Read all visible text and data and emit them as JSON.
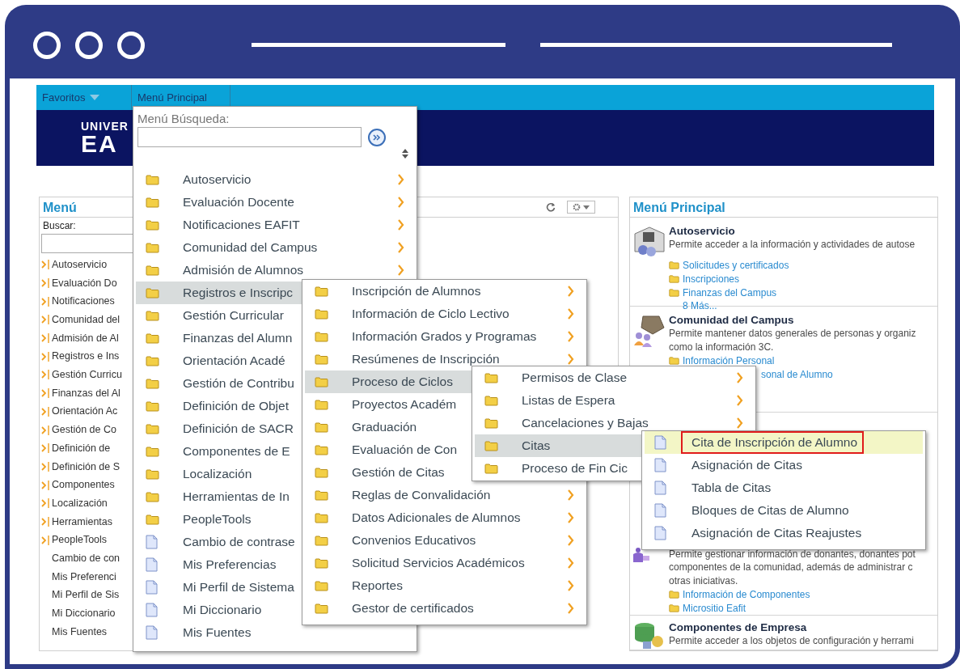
{
  "top_bar": {
    "items": [
      {
        "label": "Favoritos",
        "dropdown": true
      },
      {
        "label": "Menú Principal",
        "dropdown": false
      }
    ]
  },
  "banner": {
    "logo_lines": [
      "UNIVER",
      "EA"
    ]
  },
  "left_panel": {
    "title": "Menú",
    "search_label": "Buscar:",
    "items": [
      {
        "label": "Autoservicio",
        "kind": "folder"
      },
      {
        "label": "Evaluación Do",
        "kind": "folder"
      },
      {
        "label": "Notificaciones",
        "kind": "folder"
      },
      {
        "label": "Comunidad del",
        "kind": "folder"
      },
      {
        "label": "Admisión de Al",
        "kind": "folder"
      },
      {
        "label": "Registros e Ins",
        "kind": "folder"
      },
      {
        "label": "Gestión Curricu",
        "kind": "folder"
      },
      {
        "label": "Finanzas del Al",
        "kind": "folder"
      },
      {
        "label": "Orientación Ac",
        "kind": "folder"
      },
      {
        "label": "Gestión de Co",
        "kind": "folder"
      },
      {
        "label": "Definición de",
        "kind": "folder"
      },
      {
        "label": "Definición de S",
        "kind": "folder"
      },
      {
        "label": "Componentes",
        "kind": "folder"
      },
      {
        "label": "Localización",
        "kind": "folder"
      },
      {
        "label": "Herramientas",
        "kind": "folder"
      },
      {
        "label": "PeopleTools",
        "kind": "folder"
      },
      {
        "label": "Cambio de con",
        "kind": "page"
      },
      {
        "label": "Mis Preferenci",
        "kind": "page"
      },
      {
        "label": "Mi Perfil de Sis",
        "kind": "page"
      },
      {
        "label": "Mi Diccionario",
        "kind": "page"
      },
      {
        "label": "Mis Fuentes",
        "kind": "page"
      }
    ]
  },
  "right_panel": {
    "title": "Menú Principal",
    "sections": [
      {
        "title": "Autoservicio",
        "lines": [
          "Permite acceder a la información y actividades de autose"
        ],
        "links": [
          {
            "label": "Solicitudes y certificados",
            "kind": "folder"
          },
          {
            "label": "Inscripciones",
            "kind": "folder"
          },
          {
            "label": "Finanzas del Campus",
            "kind": "folder"
          }
        ],
        "more": "8 Más..."
      },
      {
        "title": "Comunidad del Campus",
        "lines": [
          "Permite mantener datos generales de personas y organiz",
          "como la información 3C."
        ],
        "links": [
          {
            "label": "Información Personal",
            "kind": "folder"
          },
          {
            "label": "sonal de Alumno",
            "kind": "partial"
          }
        ]
      },
      {
        "lines": [
          "Permite gestionar información de donantes, donantes pot",
          "componentes de la comunidad, además de administrar c",
          "otras iniciativas."
        ],
        "links": [
          {
            "label": "Información de Componentes",
            "kind": "folder"
          },
          {
            "label": "Micrositio Eafit",
            "kind": "folder"
          }
        ]
      },
      {
        "title": "Componentes de Empresa",
        "lines": [
          "Permite acceder a los objetos de configuración y herrami"
        ]
      }
    ]
  },
  "menus": [
    {
      "search_label": "Menú Búsqueda:",
      "items": [
        {
          "label": "Autoservicio",
          "kind": "folder",
          "arrow": true,
          "selected": false
        },
        {
          "label": "Evaluación Docente",
          "kind": "folder",
          "arrow": true,
          "selected": false
        },
        {
          "label": "Notificaciones EAFIT",
          "kind": "folder",
          "arrow": true,
          "selected": false
        },
        {
          "label": "Comunidad del Campus",
          "kind": "folder",
          "arrow": true,
          "selected": false
        },
        {
          "label": "Admisión de Alumnos",
          "kind": "folder",
          "arrow": true,
          "selected": false
        },
        {
          "label": "Registros e Inscripc",
          "kind": "folder",
          "arrow": false,
          "selected": true
        },
        {
          "label": "Gestión Curricular",
          "kind": "folder",
          "arrow": false,
          "selected": false
        },
        {
          "label": "Finanzas del Alumn",
          "kind": "folder",
          "arrow": false,
          "selected": false
        },
        {
          "label": "Orientación Acadé",
          "kind": "folder",
          "arrow": false,
          "selected": false
        },
        {
          "label": "Gestión de Contribu",
          "kind": "folder",
          "arrow": false,
          "selected": false
        },
        {
          "label": "Definición de Objet",
          "kind": "folder",
          "arrow": false,
          "selected": false
        },
        {
          "label": "Definición de SACR",
          "kind": "folder",
          "arrow": false,
          "selected": false
        },
        {
          "label": "Componentes de E",
          "kind": "folder",
          "arrow": false,
          "selected": false
        },
        {
          "label": "Localización",
          "kind": "folder",
          "arrow": false,
          "selected": false
        },
        {
          "label": "Herramientas de In",
          "kind": "folder",
          "arrow": false,
          "selected": false
        },
        {
          "label": "PeopleTools",
          "kind": "folder",
          "arrow": false,
          "selected": false
        },
        {
          "label": "Cambio de contrase",
          "kind": "page",
          "arrow": false,
          "selected": false
        },
        {
          "label": "Mis Preferencias",
          "kind": "page",
          "arrow": false,
          "selected": false
        },
        {
          "label": "Mi Perfil de Sistema",
          "kind": "page",
          "arrow": false,
          "selected": false
        },
        {
          "label": "Mi Diccionario",
          "kind": "page",
          "arrow": false,
          "selected": false
        },
        {
          "label": "Mis Fuentes",
          "kind": "page",
          "arrow": false,
          "selected": false
        }
      ]
    },
    {
      "items": [
        {
          "label": "Inscripción de Alumnos",
          "kind": "folder",
          "arrow": true,
          "selected": false
        },
        {
          "label": "Información de Ciclo Lectivo",
          "kind": "folder",
          "arrow": true,
          "selected": false
        },
        {
          "label": "Información Grados y Programas",
          "kind": "folder",
          "arrow": true,
          "selected": false
        },
        {
          "label": "Resúmenes de Inscripción",
          "kind": "folder",
          "arrow": true,
          "selected": false
        },
        {
          "label": "Proceso de Ciclos",
          "kind": "folder",
          "arrow": false,
          "selected": true
        },
        {
          "label": "Proyectos Académ",
          "kind": "folder",
          "arrow": false,
          "selected": false
        },
        {
          "label": "Graduación",
          "kind": "folder",
          "arrow": false,
          "selected": false
        },
        {
          "label": "Evaluación de Con",
          "kind": "folder",
          "arrow": false,
          "selected": false
        },
        {
          "label": "Gestión de Citas",
          "kind": "folder",
          "arrow": false,
          "selected": false
        },
        {
          "label": "Reglas de Convalidación",
          "kind": "folder",
          "arrow": true,
          "selected": false
        },
        {
          "label": "Datos Adicionales de Alumnos",
          "kind": "folder",
          "arrow": true,
          "selected": false
        },
        {
          "label": "Convenios Educativos",
          "kind": "folder",
          "arrow": true,
          "selected": false
        },
        {
          "label": "Solicitud Servicios Académicos",
          "kind": "folder",
          "arrow": true,
          "selected": false
        },
        {
          "label": "Reportes",
          "kind": "folder",
          "arrow": true,
          "selected": false
        },
        {
          "label": "Gestor de certificados",
          "kind": "folder",
          "arrow": true,
          "selected": false
        }
      ]
    },
    {
      "items": [
        {
          "label": "Permisos de Clase",
          "kind": "folder",
          "arrow": true,
          "selected": false
        },
        {
          "label": "Listas de Espera",
          "kind": "folder",
          "arrow": true,
          "selected": false
        },
        {
          "label": "Cancelaciones y Bajas",
          "kind": "folder",
          "arrow": true,
          "selected": false
        },
        {
          "label": "Citas",
          "kind": "folder",
          "arrow": false,
          "selected": true
        },
        {
          "label": "Proceso de Fin Cic",
          "kind": "folder",
          "arrow": false,
          "selected": false
        }
      ]
    },
    {
      "items": [
        {
          "label": "Cita de Inscripción de Alumno",
          "kind": "page",
          "arrow": false,
          "selected": true,
          "annotated": true
        },
        {
          "label": "Asignación de Citas",
          "kind": "page",
          "arrow": false,
          "selected": false,
          "annotated": false
        },
        {
          "label": "Tabla de Citas",
          "kind": "page",
          "arrow": false,
          "selected": false,
          "annotated": false
        },
        {
          "label": "Bloques de Citas de Alumno",
          "kind": "page",
          "arrow": false,
          "selected": false,
          "annotated": false
        },
        {
          "label": "Asignación de Citas Reajustes",
          "kind": "page",
          "arrow": false,
          "selected": false,
          "annotated": false
        }
      ]
    }
  ]
}
